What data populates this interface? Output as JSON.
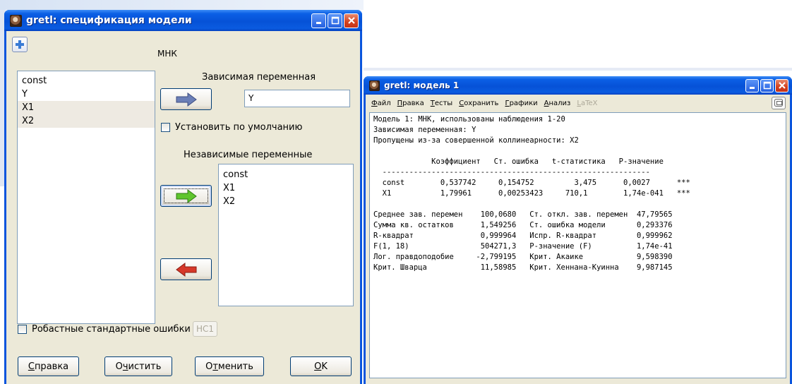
{
  "dialog": {
    "title": "gretl: спецификация модели",
    "estimator": "МНК",
    "variables": [
      "const",
      "Y",
      "X1",
      "X2"
    ],
    "dependent_label": "Зависимая переменная",
    "dependent_value": "Y",
    "set_default_label": "Установить по умолчанию",
    "independent_label": "Независимые переменные",
    "independent_vars": [
      "const",
      "X1",
      "X2"
    ],
    "robust_label": "Робастные стандартные ошибки",
    "hc_label": "HC1",
    "buttons": {
      "help": {
        "pre": "",
        "ul": "С",
        "post": "правка"
      },
      "clear": {
        "pre": "О",
        "ul": "ч",
        "post": "истить"
      },
      "cancel": {
        "pre": "О",
        "ul": "т",
        "post": "менить"
      },
      "ok": {
        "pre": "",
        "ul": "O",
        "post": "K"
      }
    }
  },
  "model_window": {
    "title": "gretl: модель 1",
    "menu": [
      {
        "ul": "Ф",
        "rest": "айл"
      },
      {
        "ul": "П",
        "rest": "равка"
      },
      {
        "ul": "Т",
        "rest": "есты"
      },
      {
        "ul": "С",
        "rest": "охранить"
      },
      {
        "ul": "Г",
        "rest": "рафики"
      },
      {
        "ul": "А",
        "rest": "нализ"
      },
      {
        "ul": "L",
        "rest": "aTeX",
        "disabled": true
      }
    ],
    "header_lines": [
      "Модель 1: МНК, использованы наблюдения 1-20",
      "Зависимая переменная: Y",
      "Пропущены из-за совершенной коллинеарности: X2"
    ],
    "table_header": "             Коэффициент   Ст. ошибка   t-статистика   P-значение",
    "table_rule": "  ------------------------------------------------------------",
    "table_rows": [
      "  const        0,537742     0,154752         3,475      0,0027      ***",
      "  X1           1,79961      0,00253423     710,1        1,74e-041   ***"
    ],
    "stats_lines": [
      "Среднее зав. перемен    100,0680   Ст. откл. зав. перемен  47,79565",
      "Сумма кв. остатков      1,549256   Ст. ошибка модели       0,293376",
      "R-квадрат               0,999964   Испр. R-квадрат         0,999962",
      "F(1, 18)                504271,3   Р-значение (F)          1,74e-41",
      "Лог. правдоподобие     -2,799195   Крит. Акаике            9,598390",
      "Крит. Шварца            11,58985   Крит. Хеннана-Куинна    9,987145"
    ]
  },
  "colors": {
    "titlebar": "#0652d7",
    "dialog_bg": "#ece9d8",
    "arrow_blue": "#6b7fb7",
    "arrow_green": "#5fc52d",
    "arrow_red": "#d6382a"
  }
}
